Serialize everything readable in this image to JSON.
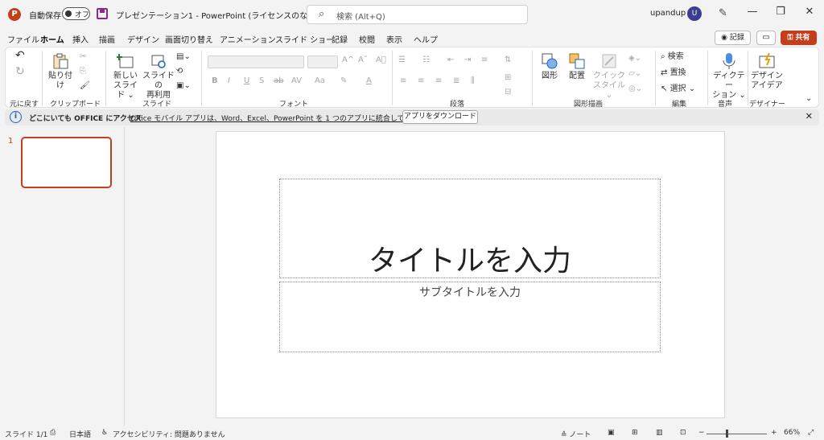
{
  "titlebar": {
    "app_logo": "P",
    "autosave_label": "自動保存",
    "autosave_state": "オフ",
    "document_title": "プレゼンテーション1 - PowerPoint (ライセンスのない製品)",
    "search_placeholder": "検索 (Alt+Q)",
    "user_name": "upandup",
    "avatar_initial": "U",
    "minimize": "—",
    "restore": "❐",
    "close": "✕"
  },
  "tabs": [
    {
      "label": "ファイル"
    },
    {
      "label": "ホーム",
      "active": true
    },
    {
      "label": "挿入"
    },
    {
      "label": "描画"
    },
    {
      "label": "デザイン"
    },
    {
      "label": "画面切り替え"
    },
    {
      "label": "アニメーション"
    },
    {
      "label": "スライド ショー"
    },
    {
      "label": "記録"
    },
    {
      "label": "校閲"
    },
    {
      "label": "表示"
    },
    {
      "label": "ヘルプ"
    }
  ],
  "actions": {
    "record": "◉ 記録",
    "comment": "▭",
    "share": "⚿ 共有"
  },
  "ribbon": {
    "groups": {
      "undo": "元に戻す",
      "clipboard": "クリップボード",
      "slides": "スライド",
      "font": "フォント",
      "paragraph": "段落",
      "drawing": "図形描画",
      "editing": "編集",
      "voice": "音声",
      "designer": "デザイナー"
    },
    "paste": "貼り付け",
    "new_slide_1": "新しい",
    "new_slide_2": "スライド ⌄",
    "reuse_1": "スライドの",
    "reuse_2": "再利用",
    "shapes": "図形",
    "arrange": "配置",
    "quick_style_1": "クイック",
    "quick_style_2": "スタイル ⌄",
    "find": "検索",
    "replace": "置換",
    "select": "選択 ⌄",
    "dictate_1": "ディクテー",
    "dictate_2": "ション ⌄",
    "design_ideas_1": "デザイン",
    "design_ideas_2": "アイデア",
    "font_buttons": [
      "B",
      "I",
      "U",
      "S",
      "ab",
      "AV",
      "Aa",
      "A"
    ],
    "grow_font": "A^",
    "shrink_font": "Aˇ",
    "clear_format": "A⃠"
  },
  "infobar": {
    "bold": "どこにいても OFFICE にアクセス",
    "text": "Office モバイル アプリは、Word、Excel、PowerPoint を 1 つのアプリに統合しています。",
    "button": "アプリをダウンロード",
    "close": "✕"
  },
  "thumbnails": {
    "number": "1"
  },
  "slide": {
    "title_placeholder": "タイトルを入力",
    "subtitle_placeholder": "サブタイトルを入力"
  },
  "status": {
    "slide_count": "スライド 1/1",
    "language": "日本語",
    "accessibility": "アクセシビリティ: 問題ありません",
    "notes": "≙ ノート",
    "zoom_minus": "−",
    "zoom_plus": "+",
    "zoom": "66%",
    "zoom_level": 0.66
  },
  "colors": {
    "accent": "#c43e1c",
    "avatar": "#3b3e8f",
    "info": "#1a63c7"
  }
}
